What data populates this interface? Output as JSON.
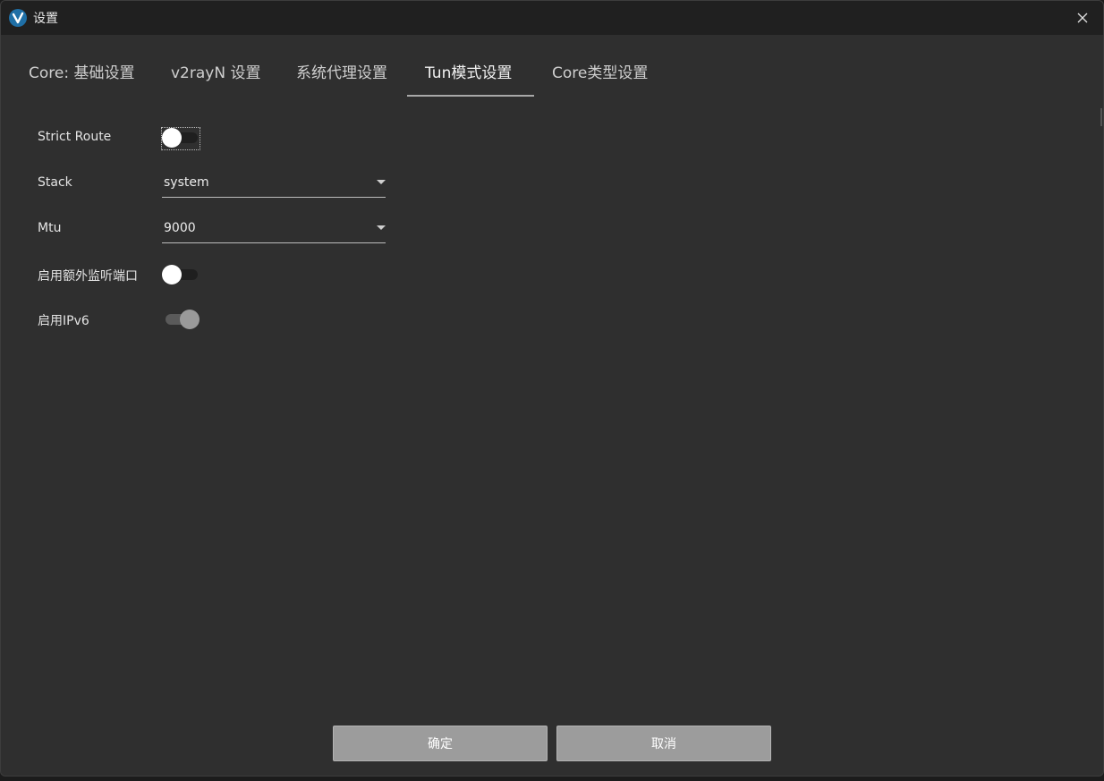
{
  "window": {
    "title": "设置",
    "app_icon": "v2rayn-logo-icon",
    "close_icon": "close-icon"
  },
  "tabs": [
    {
      "label": "Core: 基础设置",
      "active": false
    },
    {
      "label": "v2rayN 设置",
      "active": false
    },
    {
      "label": "系统代理设置",
      "active": false
    },
    {
      "label": "Tun模式设置",
      "active": true
    },
    {
      "label": "Core类型设置",
      "active": false
    }
  ],
  "settings": {
    "strict_route": {
      "label": "Strict Route",
      "enabled": false
    },
    "stack": {
      "label": "Stack",
      "value": "system"
    },
    "mtu": {
      "label": "Mtu",
      "value": "9000"
    },
    "extra_listen_port": {
      "label": "启用额外监听端口",
      "enabled": false
    },
    "ipv6": {
      "label": "启用IPv6",
      "enabled": true
    }
  },
  "buttons": {
    "ok": "确定",
    "cancel": "取消"
  },
  "colors": {
    "window_bg": "#2f2f2f",
    "titlebar_bg": "#202020",
    "button_bg": "#9c9c9c"
  }
}
